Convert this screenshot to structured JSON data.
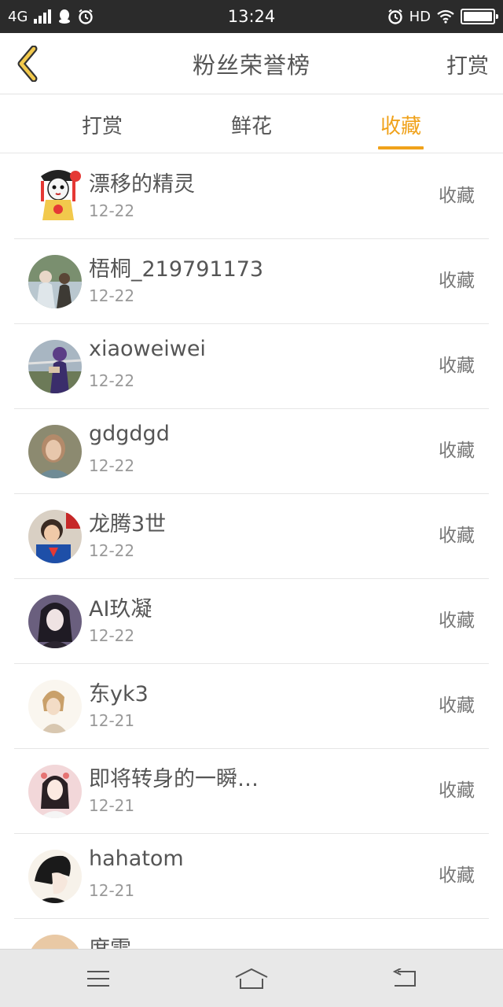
{
  "status_bar": {
    "network": "4G",
    "time": "13:24",
    "hd": "HD",
    "icons": [
      "signal-icon",
      "qq-icon",
      "alarm-icon",
      "wifi-icon",
      "battery-icon"
    ]
  },
  "header": {
    "title": "粉丝荣誉榜",
    "action_label": "打赏",
    "back_icon": "chevron-left-icon"
  },
  "tabs": [
    {
      "label": "打赏",
      "active": false
    },
    {
      "label": "鲜花",
      "active": false
    },
    {
      "label": "收藏",
      "active": true
    }
  ],
  "colors": {
    "accent": "#f0a21b",
    "text_primary": "#555555",
    "text_secondary": "#999999",
    "status_bar": "#2b2b2b",
    "nav_bar": "#e8e8e8"
  },
  "fans": [
    {
      "name": "漂移的精灵",
      "date": "12-22",
      "action": "收藏"
    },
    {
      "name": "梧桐_219791173",
      "date": "12-22",
      "action": "收藏"
    },
    {
      "name": "xiaoweiwei",
      "date": "12-22",
      "action": "收藏"
    },
    {
      "name": "gdgdgd",
      "date": "12-22",
      "action": "收藏"
    },
    {
      "name": "龙腾3世",
      "date": "12-22",
      "action": "收藏"
    },
    {
      "name": "AI玖凝",
      "date": "12-22",
      "action": "收藏"
    },
    {
      "name": "东yk3",
      "date": "12-21",
      "action": "收藏"
    },
    {
      "name": "即将转身的一瞬…",
      "date": "12-21",
      "action": "收藏"
    },
    {
      "name": "hahatom",
      "date": "12-21",
      "action": "收藏"
    },
    {
      "name": "席雷",
      "date": "",
      "action": ""
    }
  ],
  "nav": {
    "icons": [
      "menu-icon",
      "home-icon",
      "back-icon"
    ]
  }
}
